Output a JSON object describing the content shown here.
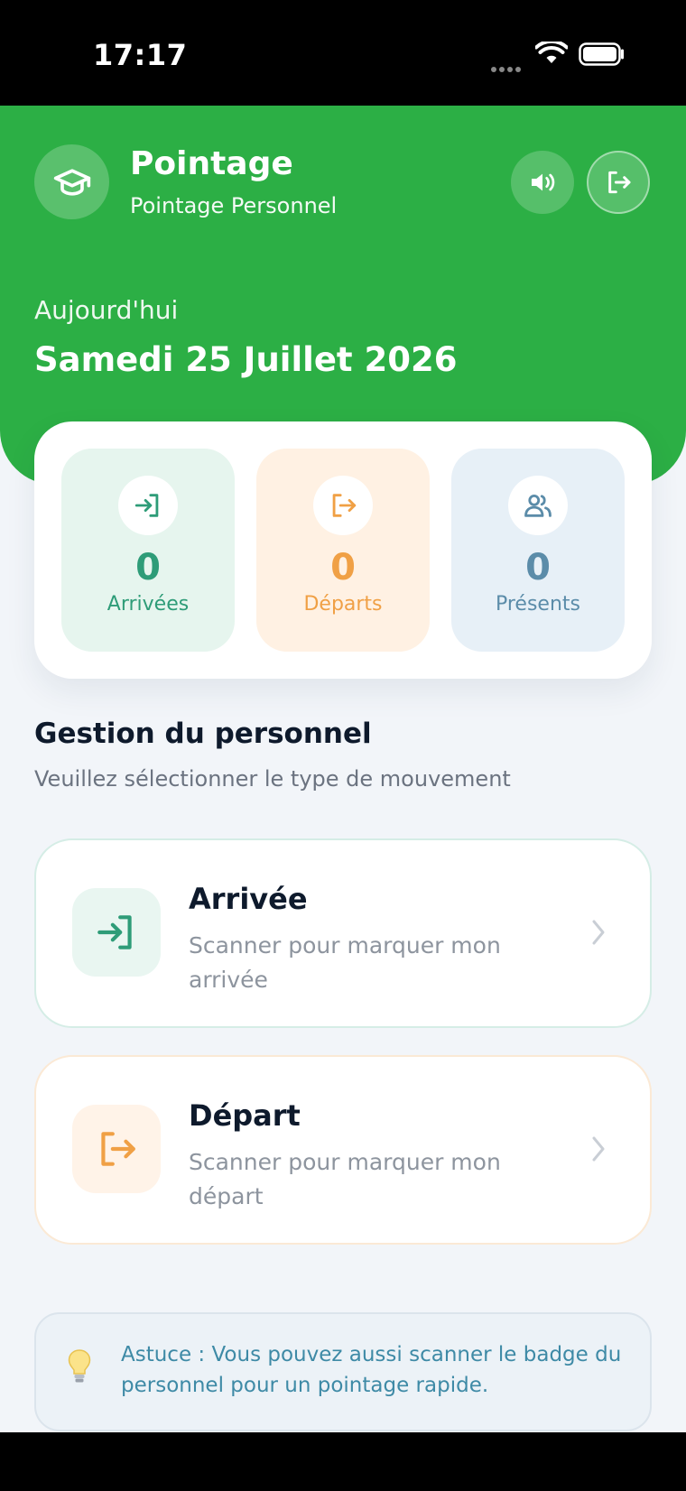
{
  "status_bar": {
    "time": "17:17"
  },
  "header": {
    "title": "Pointage",
    "subtitle": "Pointage Personnel",
    "today_label": "Aujourd'hui",
    "date": "Samedi 25 Juillet 2026",
    "color": "#2caf45"
  },
  "stats": [
    {
      "value": "0",
      "label": "Arrivées",
      "icon": "login-icon",
      "color": "#2e9c78"
    },
    {
      "value": "0",
      "label": "Départs",
      "icon": "logout-icon",
      "color": "#f0a045"
    },
    {
      "value": "0",
      "label": "Présents",
      "icon": "users-icon",
      "color": "#5b8ca9"
    }
  ],
  "section": {
    "title": "Gestion du personnel",
    "subtitle": "Veuillez sélectionner le type de mouvement"
  },
  "actions": [
    {
      "title": "Arrivée",
      "description": "Scanner pour marquer mon arrivée",
      "icon": "login-icon"
    },
    {
      "title": "Départ",
      "description": "Scanner pour marquer mon départ",
      "icon": "logout-icon"
    }
  ],
  "tip": {
    "text": "Astuce : Vous pouvez aussi scanner le badge du personnel pour un pointage rapide.",
    "icon": "lightbulb-icon"
  }
}
